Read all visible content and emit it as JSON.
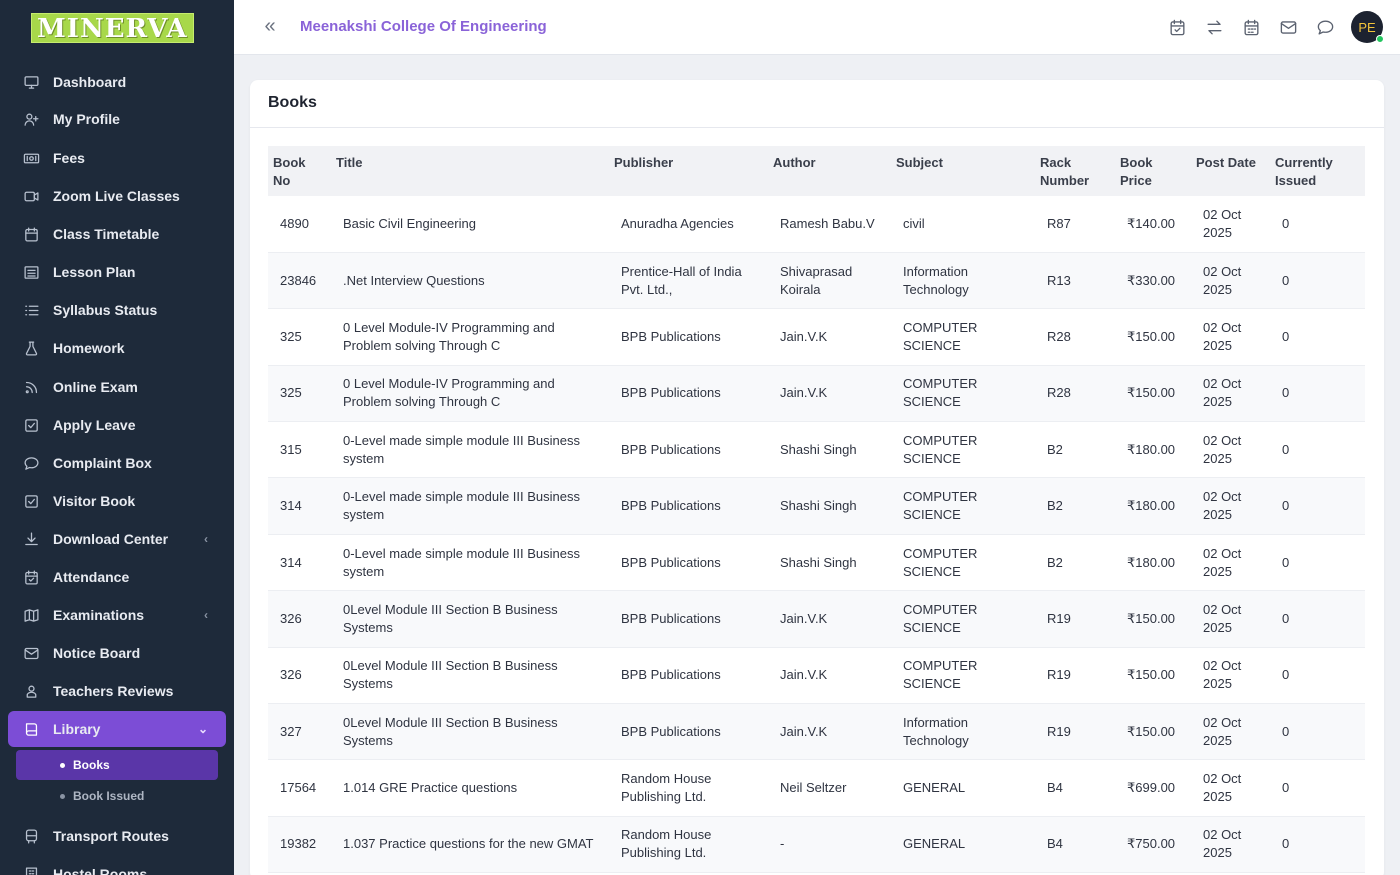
{
  "app": {
    "logo_text": "MINERVA",
    "college_name": "Meenakshi College Of Engineering",
    "avatar_initials": "PE"
  },
  "colors": {
    "sidebar_bg": "#1e2a3a",
    "accent": "#7c4dd6",
    "college_text": "#8a63d8",
    "logo_bg": "#a8d84a"
  },
  "sidebar": {
    "items": [
      {
        "label": "Dashboard",
        "icon": "monitor-icon"
      },
      {
        "label": "My Profile",
        "icon": "user-plus-icon"
      },
      {
        "label": "Fees",
        "icon": "money-icon"
      },
      {
        "label": "Zoom Live Classes",
        "icon": "video-icon"
      },
      {
        "label": "Class Timetable",
        "icon": "calendar-icon"
      },
      {
        "label": "Lesson Plan",
        "icon": "list-icon"
      },
      {
        "label": "Syllabus Status",
        "icon": "list-check-icon"
      },
      {
        "label": "Homework",
        "icon": "flask-icon"
      },
      {
        "label": "Online Exam",
        "icon": "rss-icon"
      },
      {
        "label": "Apply Leave",
        "icon": "check-square-icon"
      },
      {
        "label": "Complaint Box",
        "icon": "chat-icon"
      },
      {
        "label": "Visitor Book",
        "icon": "check-square-icon"
      },
      {
        "label": "Download Center",
        "icon": "download-icon"
      },
      {
        "label": "Attendance",
        "icon": "calendar-check-icon"
      },
      {
        "label": "Examinations",
        "icon": "map-icon"
      },
      {
        "label": "Notice Board",
        "icon": "mail-icon"
      },
      {
        "label": "Teachers Reviews",
        "icon": "users-icon"
      },
      {
        "label": "Library",
        "icon": "book-icon"
      },
      {
        "label": "Transport Routes",
        "icon": "bus-icon"
      },
      {
        "label": "Hostel Rooms",
        "icon": "building-icon"
      }
    ],
    "library_sub": [
      {
        "label": "Books"
      },
      {
        "label": "Book Issued"
      }
    ]
  },
  "header_icons": [
    "calendar-check-icon",
    "swap-icon",
    "calendar-icon",
    "mail-icon",
    "chat-bubble-icon"
  ],
  "page": {
    "title": "Books"
  },
  "table": {
    "columns": [
      "Book No",
      "Title",
      "Publisher",
      "Author",
      "Subject",
      "Rack Number",
      "Book Price",
      "Post Date",
      "Currently Issued"
    ],
    "rows": [
      [
        "4890",
        "Basic Civil Engineering",
        "Anuradha Agencies",
        "Ramesh Babu.V",
        "civil",
        "R87",
        "₹140.00",
        "02 Oct 2025",
        "0"
      ],
      [
        "23846",
        ".Net Interview Questions",
        "Prentice-Hall of India Pvt. Ltd.,",
        "Shivaprasad Koirala",
        "Information Technology",
        "R13",
        "₹330.00",
        "02 Oct 2025",
        "0"
      ],
      [
        "325",
        "0 Level Module-IV Programming and Problem solving Through C",
        "BPB Publications",
        "Jain.V.K",
        "COMPUTER SCIENCE",
        "R28",
        "₹150.00",
        "02 Oct 2025",
        "0"
      ],
      [
        "325",
        "0 Level Module-IV Programming and Problem solving Through C",
        "BPB Publications",
        "Jain.V.K",
        "COMPUTER SCIENCE",
        "R28",
        "₹150.00",
        "02 Oct 2025",
        "0"
      ],
      [
        "315",
        "0-Level made simple module III Business system",
        "BPB Publications",
        "Shashi Singh",
        "COMPUTER SCIENCE",
        "B2",
        "₹180.00",
        "02 Oct 2025",
        "0"
      ],
      [
        "314",
        "0-Level made simple module III Business system",
        "BPB Publications",
        "Shashi Singh",
        "COMPUTER SCIENCE",
        "B2",
        "₹180.00",
        "02 Oct 2025",
        "0"
      ],
      [
        "314",
        "0-Level made simple module III Business system",
        "BPB Publications",
        "Shashi Singh",
        "COMPUTER SCIENCE",
        "B2",
        "₹180.00",
        "02 Oct 2025",
        "0"
      ],
      [
        "326",
        "0Level Module III Section B Business Systems",
        "BPB Publications",
        "Jain.V.K",
        "COMPUTER SCIENCE",
        "R19",
        "₹150.00",
        "02 Oct 2025",
        "0"
      ],
      [
        "326",
        "0Level Module III Section B Business Systems",
        "BPB Publications",
        "Jain.V.K",
        "COMPUTER SCIENCE",
        "R19",
        "₹150.00",
        "02 Oct 2025",
        "0"
      ],
      [
        "327",
        "0Level Module III Section B Business Systems",
        "BPB Publications",
        "Jain.V.K",
        "Information Technology",
        "R19",
        "₹150.00",
        "02 Oct 2025",
        "0"
      ],
      [
        "17564",
        "1.014 GRE Practice questions",
        "Random House Publishing Ltd.",
        "Neil Seltzer",
        "GENERAL",
        "B4",
        "₹699.00",
        "02 Oct 2025",
        "0"
      ],
      [
        "19382",
        "1.037 Practice questions for the new GMAT",
        "Random House Publishing Ltd.",
        "-",
        "GENERAL",
        "B4",
        "₹750.00",
        "02 Oct 2025",
        "0"
      ]
    ]
  }
}
